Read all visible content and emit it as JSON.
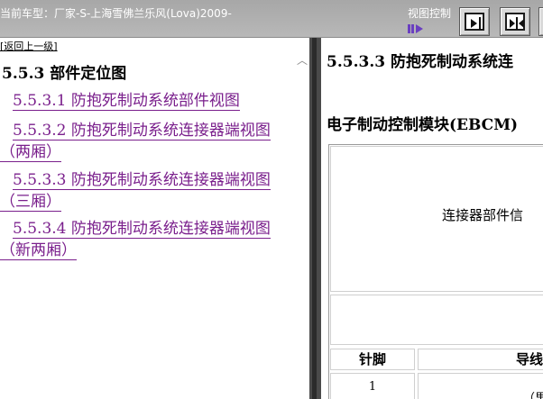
{
  "topbar": {
    "car_info": "当前车型：厂家-S-上海雪佛兰乐风(Lova)2009-",
    "view_control_label": "视图控制"
  },
  "left": {
    "back_link": "[返回上一级]",
    "section_title": "5.5.3 部件定位图",
    "toc": [
      "5.5.3.1 防抱死制动系统部件视图",
      "5.5.3.2 防抱死制动系统连接器端视图（两厢）",
      "5.5.3.3 防抱死制动系统连接器端视图（三厢）",
      "5.5.3.4 防抱死制动系统连接器端视图（新两厢）"
    ]
  },
  "right": {
    "doc_title": "5.5.3.3 防抱死制动系统连",
    "module_title": "电子制动控制模块(EBCM)",
    "table": {
      "connector_info": "连接器部件信",
      "headers": [
        "针脚",
        "导线"
      ],
      "rows": [
        [
          "1",
          "（里"
        ]
      ]
    }
  },
  "colors": {
    "link": "#7a1f8c",
    "topbar": "#b0b0b0",
    "splitter": "#4a4a4a"
  },
  "icons": [
    "slider-icon",
    "expand-right-icon",
    "split-view-icon",
    "expand-left-icon"
  ]
}
